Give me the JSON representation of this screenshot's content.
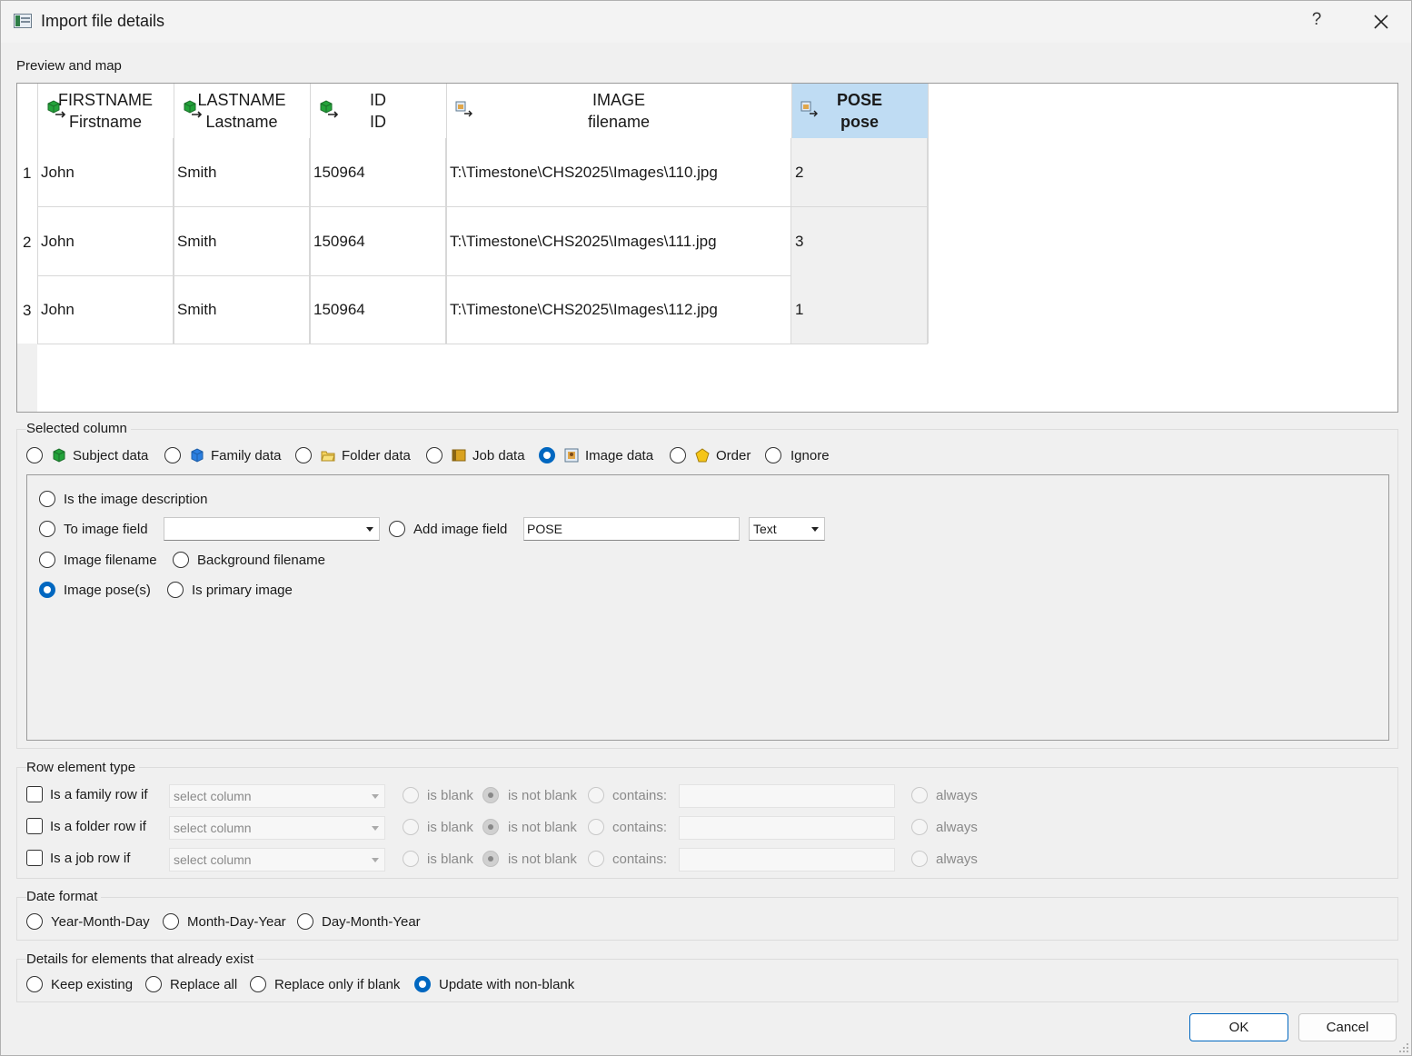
{
  "window": {
    "title": "Import file details",
    "help": "?"
  },
  "preview": {
    "label": "Preview and map",
    "columns": [
      {
        "top": "FIRSTNAME",
        "sub": "Firstname"
      },
      {
        "top": "LASTNAME",
        "sub": "Lastname"
      },
      {
        "top": "ID",
        "sub": "ID"
      },
      {
        "top": "IMAGE",
        "sub": "filename"
      },
      {
        "top": "POSE",
        "sub": "pose"
      }
    ],
    "rows": [
      {
        "num": "1",
        "cells": [
          "John",
          "Smith",
          "150964",
          "T:\\Timestone\\CHS2025\\Images\\110.jpg",
          "2"
        ]
      },
      {
        "num": "2",
        "cells": [
          "John",
          "Smith",
          "150964",
          "T:\\Timestone\\CHS2025\\Images\\111.jpg",
          "3"
        ]
      },
      {
        "num": "3",
        "cells": [
          "John",
          "Smith",
          "150964",
          "T:\\Timestone\\CHS2025\\Images\\112.jpg",
          "1"
        ]
      }
    ]
  },
  "selected_column": {
    "label": "Selected column",
    "types": [
      "Subject data",
      "Family data",
      "Folder data",
      "Job data",
      "Image data",
      "Order",
      "Ignore"
    ],
    "selected": "Image data",
    "options": {
      "is_description": "Is the image description",
      "to_image_field": "To image field",
      "to_image_field_value": "",
      "add_image_field": "Add image field",
      "add_image_field_value": "POSE",
      "field_type": "Text",
      "image_filename": "Image filename",
      "background_filename": "Background filename",
      "image_poses": "Image pose(s)",
      "is_primary": "Is primary image"
    }
  },
  "row_element": {
    "label": "Row element type",
    "rows": [
      {
        "label": "Is a family row if",
        "select": "select column"
      },
      {
        "label": "Is a folder row if",
        "select": "select column"
      },
      {
        "label": "Is a job row if",
        "select": "select column"
      }
    ],
    "is_blank": "is blank",
    "is_not_blank": "is not blank",
    "contains": "contains:",
    "always": "always"
  },
  "date_format": {
    "label": "Date format",
    "options": [
      "Year-Month-Day",
      "Month-Day-Year",
      "Day-Month-Year"
    ]
  },
  "existing": {
    "label": "Details for elements that already exist",
    "options": [
      "Keep existing",
      "Replace all",
      "Replace only if blank",
      "Update with non-blank"
    ],
    "selected": "Update with non-blank"
  },
  "buttons": {
    "ok": "OK",
    "cancel": "Cancel"
  },
  "colors": {
    "accent": "#0067c0",
    "header_selected": "#bfdcf3"
  }
}
